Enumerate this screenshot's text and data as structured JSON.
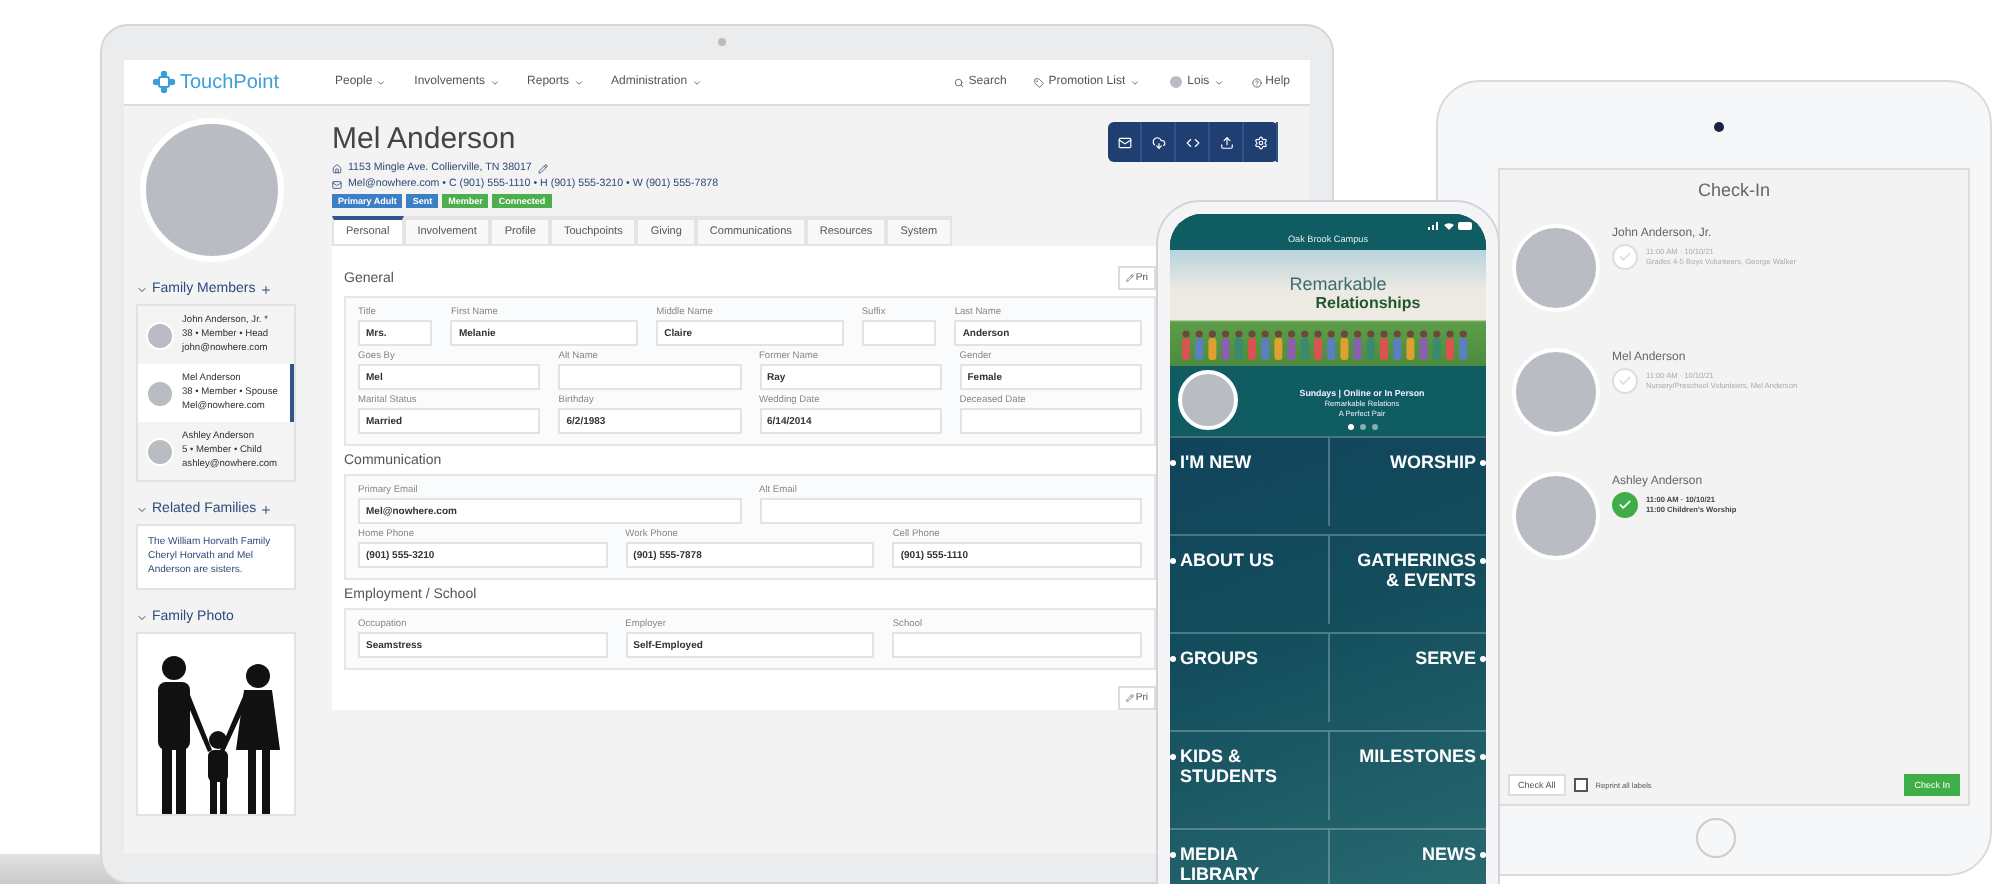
{
  "laptop": {
    "nav": {
      "logo": "TouchPoint",
      "menus": [
        "People",
        "Involvements",
        "Reports",
        "Administration"
      ],
      "search": "Search",
      "promotion": "Promotion List",
      "user": "Lois",
      "help": "Help"
    },
    "sidebar": {
      "family_heading": "Family Members",
      "family": [
        {
          "name": "John Anderson, Jr. *",
          "detail": "38 • Member • Head",
          "email": "john@nowhere.com",
          "selected": false
        },
        {
          "name": "Mel Anderson",
          "detail": "38 • Member • Spouse",
          "email": "Mel@nowhere.com",
          "selected": true
        },
        {
          "name": "Ashley Anderson",
          "detail": "5 • Member • Child",
          "email": "ashley@nowhere.com",
          "selected": false
        }
      ],
      "related_heading": "Related Families",
      "related_text": "The William Horvath Family Cheryl Horvath and Mel Anderson are sisters.",
      "photo_heading": "Family Photo"
    },
    "profile": {
      "name": "Mel Anderson",
      "address": "1153 Mingle Ave. Collierville, TN 38017",
      "contact": "Mel@nowhere.com • C (901) 555-1110 • H (901) 555-3210 • W (901) 555-7878",
      "badges": [
        {
          "label": "Primary Adult",
          "color": "#3b7fc4"
        },
        {
          "label": "Sent",
          "color": "#3b7fc4"
        },
        {
          "label": "Member",
          "color": "#4cae4c"
        },
        {
          "label": "Connected",
          "color": "#4cae4c"
        }
      ]
    },
    "tabs": [
      {
        "label": "Personal",
        "selected": true
      },
      {
        "label": "Involvement",
        "selected": false
      },
      {
        "label": "Profile",
        "selected": false
      },
      {
        "label": "Touchpoints",
        "selected": false
      },
      {
        "label": "Giving",
        "selected": false
      },
      {
        "label": "Communications",
        "selected": false
      },
      {
        "label": "Resources",
        "selected": false
      },
      {
        "label": "System",
        "selected": false
      }
    ],
    "print_button": "Pri",
    "print_button_bottom": "Pri",
    "sections": [
      {
        "title": "General",
        "rows": [
          [
            {
              "label": "Title",
              "value": "Mrs."
            },
            {
              "label": "First Name",
              "value": "Melanie"
            },
            {
              "label": "Middle Name",
              "value": "Claire"
            },
            {
              "label": "Suffix"
            },
            {
              "label": "Last Name",
              "value": "Anderson"
            }
          ],
          [
            {
              "label": "Goes By",
              "value": "Mel"
            },
            {
              "label": "Alt Name"
            },
            {
              "label": "Former Name",
              "value": "Ray"
            },
            {
              "label": "Gender",
              "value": "Female"
            }
          ],
          [
            {
              "label": "Marital Status",
              "value": "Married"
            },
            {
              "label": "Birthday",
              "value": "6/2/1983"
            },
            {
              "label": "Wedding Date",
              "value": "6/14/2014"
            },
            {
              "label": "Deceased Date"
            }
          ]
        ]
      },
      {
        "title": "Communication",
        "rows": [
          [
            {
              "label": "Primary Email",
              "value": "Mel@nowhere.com"
            },
            {
              "label": "Alt Email"
            }
          ],
          [
            {
              "label": "Home Phone",
              "value": "(901) 555-3210"
            },
            {
              "label": "Work Phone",
              "value": "(901) 555-7878"
            },
            {
              "label": "Cell Phone",
              "value": "(901) 555-1110"
            }
          ]
        ]
      },
      {
        "title": "Employment / School",
        "rows": [
          [
            {
              "label": "Occupation",
              "value": "Seamstress"
            },
            {
              "label": "Employer",
              "value": "Self-Employed"
            },
            {
              "label": "School"
            }
          ]
        ]
      }
    ]
  },
  "phone": {
    "campus": "Oak Brook Campus",
    "banner_title": "Remarkable",
    "banner_subtitle": "Relationships",
    "schedule": "Sundays | Online or In Person",
    "tagline": "Remarkable Relations",
    "tagline_2": "A Perfect Pair",
    "dots": [
      {
        "selected": true
      },
      {
        "selected": false
      },
      {
        "selected": false
      }
    ],
    "menu": [
      "I'M NEW",
      "WORSHIP",
      "ABOUT US",
      "GATHERINGS & EVENTS",
      "GROUPS",
      "SERVE",
      "KIDS & STUDENTS",
      "MILESTONES",
      "MEDIA LIBRARY",
      "NEWS"
    ]
  },
  "tablet": {
    "title": "Check-In",
    "people": [
      {
        "name": "John Anderson, Jr.",
        "time": "11:00 AM · 10/10/21",
        "detail": "Grades 4-5 Boys Volunteers, George Walker",
        "checked": false
      },
      {
        "name": "Mel Anderson",
        "time": "11:00 AM · 10/10/21",
        "detail": "Nursery/Preschool Volunteers, Mel Anderson",
        "checked": false
      },
      {
        "name": "Ashley Anderson",
        "time": "11:00 AM · 10/10/21",
        "detail": "11:00 Children's Worship",
        "checked": true
      }
    ],
    "check_all": "Check All",
    "reprint": {
      "label": "Reprint all labels",
      "checked": false
    },
    "check_in": "Check In"
  }
}
